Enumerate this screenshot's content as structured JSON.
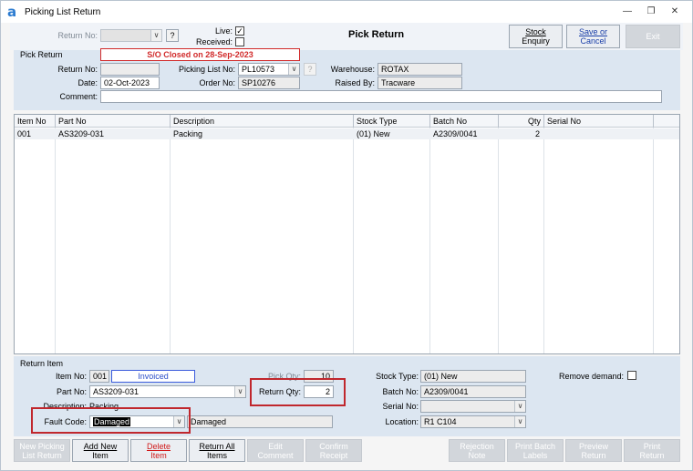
{
  "window": {
    "title": "Picking List Return",
    "logo": "a"
  },
  "header": {
    "return_no_label": "Return No:",
    "return_no_value": "",
    "live_label": "Live:",
    "live_checked": "✓",
    "received_label": "Received:",
    "received_checked": "",
    "heading": "Pick Return",
    "stock_enquiry_label_line1": "Stock",
    "stock_enquiry_label_line2": "Enquiry",
    "save_cancel_line1": "Save or",
    "save_cancel_line2": "Cancel",
    "exit_label": "Exit"
  },
  "pick_return": {
    "section_title": "Pick Return",
    "banner": "S/O Closed on 28-Sep-2023",
    "return_no_label": "Return No:",
    "return_no_value": "",
    "date_label": "Date:",
    "date_value": "02-Oct-2023",
    "comment_label": "Comment:",
    "comment_value": "",
    "picking_list_no_label": "Picking List No:",
    "picking_list_no_value": "PL10573",
    "order_no_label": "Order No:",
    "order_no_value": "SP10276",
    "warehouse_label": "Warehouse:",
    "warehouse_value": "ROTAX",
    "raised_by_label": "Raised By:",
    "raised_by_value": "Tracware"
  },
  "grid": {
    "columns": [
      "Item No",
      "Part No",
      "Description",
      "Stock Type",
      "Batch No",
      "Qty",
      "Serial No"
    ],
    "rows": [
      {
        "item_no": "001",
        "part_no": "AS3209-031",
        "description": "Packing",
        "stock_type": "(01) New",
        "batch_no": "A2309/0041",
        "qty": "2",
        "serial_no": ""
      }
    ]
  },
  "return_item": {
    "section_title": "Return Item",
    "item_no_label": "Item No:",
    "item_no_value": "001",
    "status_value": "Invoiced",
    "part_no_label": "Part No:",
    "part_no_value": "AS3209-031",
    "description_label": "Description:",
    "description_value": "Packing",
    "fault_code_label": "Fault Code:",
    "fault_code_value": "Damaged",
    "fault_code_desc": "Damaged",
    "pick_qty_label": "Pick Qty:",
    "pick_qty_value": "10",
    "return_qty_label": "Return Qty:",
    "return_qty_value": "2",
    "stock_type_label": "Stock Type:",
    "stock_type_value": "(01) New",
    "batch_no_label": "Batch No:",
    "batch_no_value": "A2309/0041",
    "serial_no_label": "Serial No:",
    "serial_no_value": "",
    "location_label": "Location:",
    "location_value": "R1 C104",
    "remove_demand_label": "Remove demand:"
  },
  "footer": {
    "new_picking_line1": "New Picking",
    "new_picking_line2": "List Return",
    "add_new_line1": "Add New",
    "add_new_line2": "Item",
    "delete_line1": "Delete",
    "delete_line2": "Item",
    "return_all_line1": "Return All",
    "return_all_line2": "Items",
    "edit_comment_line1": "Edit",
    "edit_comment_line2": "Comment",
    "confirm_receipt_line1": "Confirm",
    "confirm_receipt_line2": "Receipt",
    "rejection_line1": "Rejection",
    "rejection_line2": "Note",
    "print_batch_line1": "Print Batch",
    "print_batch_line2": "Labels",
    "preview_line1": "Preview",
    "preview_line2": "Return",
    "print_return_line1": "Print",
    "print_return_line2": "Return"
  },
  "colors": {
    "highlight": "#c0272d",
    "panel": "#dce6f1",
    "banner_red": "#d12a2a"
  }
}
